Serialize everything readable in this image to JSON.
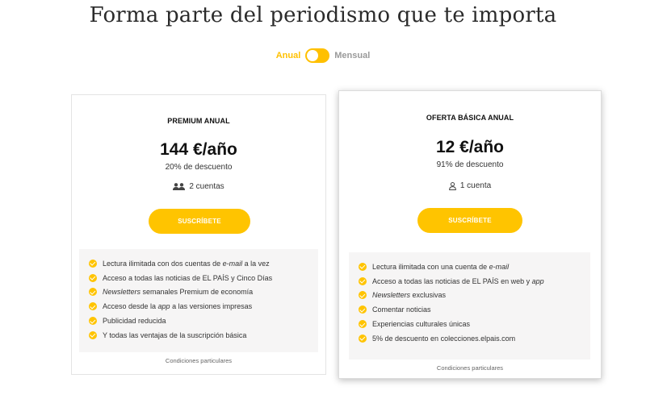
{
  "header": {
    "title": "Forma parte del periodismo que te importa"
  },
  "billing_toggle": {
    "annual_label": "Anual",
    "monthly_label": "Mensual"
  },
  "colors": {
    "accent": "#ffc400",
    "text": "#222222",
    "benefits_bg": "#f6f5f5"
  },
  "plans": [
    {
      "name": "PREMIUM ANUAL",
      "price": "144 €/año",
      "discount": "20% de descuento",
      "accounts_icon": "two-users-icon",
      "accounts": "2 cuentas",
      "cta": "SUSCRÍBETE",
      "benefits": [
        {
          "pre": "Lectura ilimitada con dos cuentas de ",
          "em": "e-mail",
          "post": " a la vez"
        },
        {
          "pre": "Acceso a todas las noticias de EL PAÍS y Cinco Días",
          "em": "",
          "post": ""
        },
        {
          "pre": "",
          "em": "Newsletters",
          "post": " semanales Premium de economía"
        },
        {
          "pre": "Acceso desde la ",
          "em": "app",
          "post": " a las versiones impresas"
        },
        {
          "pre": "Publicidad reducida",
          "em": "",
          "post": ""
        },
        {
          "pre": "Y todas las ventajas de la suscripción básica",
          "em": "",
          "post": ""
        }
      ],
      "conditions": "Condiciones particulares"
    },
    {
      "name": "OFERTA BÁSICA ANUAL",
      "price": "12 €/año",
      "discount": "91% de descuento",
      "accounts_icon": "user-icon",
      "accounts": "1 cuenta",
      "cta": "SUSCRÍBETE",
      "benefits": [
        {
          "pre": "Lectura ilimitada con una cuenta de ",
          "em": "e-mail",
          "post": ""
        },
        {
          "pre": "Acceso a todas las noticias de EL PAÍS en web y ",
          "em": "app",
          "post": ""
        },
        {
          "pre": "",
          "em": "Newsletters",
          "post": " exclusivas"
        },
        {
          "pre": "Comentar noticias",
          "em": "",
          "post": ""
        },
        {
          "pre": "Experiencias culturales únicas",
          "em": "",
          "post": ""
        },
        {
          "pre": "5% de descuento en colecciones.elpais.com",
          "em": "",
          "post": ""
        }
      ],
      "conditions": "Condiciones particulares"
    }
  ]
}
